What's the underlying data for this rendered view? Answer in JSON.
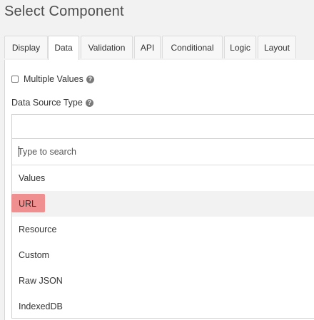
{
  "page_title": "Select Component",
  "tabs": [
    {
      "label": "Display",
      "active": false
    },
    {
      "label": "Data",
      "active": true
    },
    {
      "label": "Validation",
      "active": false
    },
    {
      "label": "API",
      "active": false
    },
    {
      "label": "Conditional",
      "active": false
    },
    {
      "label": "Logic",
      "active": false
    },
    {
      "label": "Layout",
      "active": false
    }
  ],
  "multiple_values": {
    "label": "Multiple Values",
    "checked": false,
    "help_icon": "question-circle-icon"
  },
  "data_source_type": {
    "label": "Data Source Type",
    "help_icon": "question-circle-icon",
    "search_placeholder": "Type to search",
    "options": [
      "Values",
      "URL",
      "Resource",
      "Custom",
      "Raw JSON",
      "IndexedDB"
    ],
    "highlighted_option": "URL"
  },
  "colors": {
    "highlight_marker": "#f07e7e",
    "active_tab_bg": "#ffffff",
    "page_bg": "#f2f2f2"
  }
}
